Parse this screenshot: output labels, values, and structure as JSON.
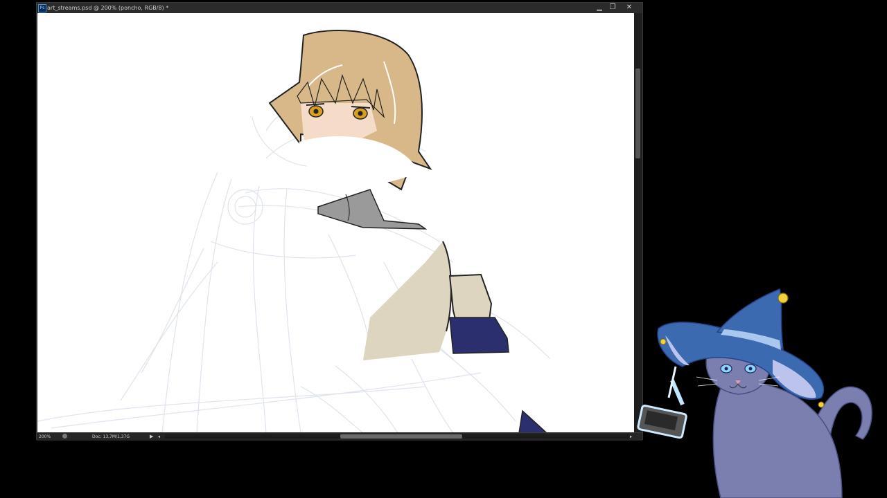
{
  "window": {
    "title": "art_streams.psd @ 200% (poncho, RGB/8) *",
    "app_icon": "Ps",
    "controls": {
      "minimize": "▁",
      "maximize": "❐",
      "close": "✕"
    }
  },
  "statusbar": {
    "zoom": "200%",
    "doc_size": "Doc: 13,7M/1,37G",
    "arrow": "▶",
    "scroll_left": "◂",
    "scroll_right": "▸"
  },
  "colors": {
    "hair": "#d8b888",
    "skin": "#f5dcc8",
    "eyes": "#d9a020",
    "poncho": "#ddd5bf",
    "undershirt": "#9a9a9a",
    "coat": "#2c2f6e",
    "sketch": "#dfe3ee",
    "mascot_fur": "#7a7fb0",
    "mascot_hat": "#3b6ab0"
  }
}
